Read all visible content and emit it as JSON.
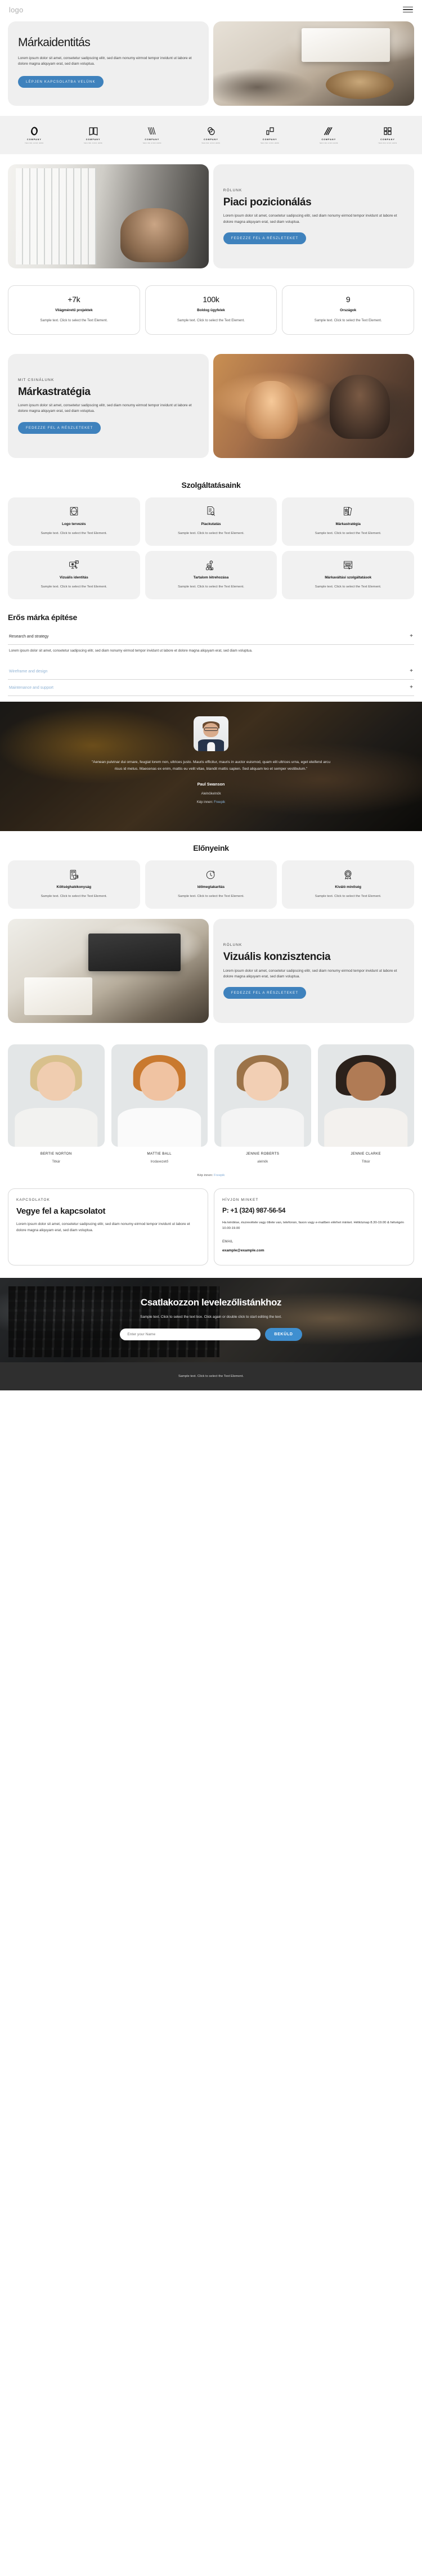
{
  "header": {
    "logo": "logo",
    "menu_icon": "hamburger-menu-icon"
  },
  "hero": {
    "title": "Márkaidentitás",
    "paragraph": "Lorem ipsum dolor sit amet, consetetur sadipscing elitr, sed diam nonumy eirmod tempor invidunt ut labore et dolore magna aliquyam erat, sed diam voluptua.",
    "cta": "LÉPJEN KAPCSOLATBA VELÜNK"
  },
  "logos": [
    {
      "name": "COMPANY",
      "tagline": "TAGLINE GOES HERE"
    },
    {
      "name": "COMPANY",
      "tagline": "TAGLINE GOES HERE"
    },
    {
      "name": "COMPANY",
      "tagline": "TAGLINE GOES HERE"
    },
    {
      "name": "COMPANY",
      "tagline": "TAGLINE GOES HERE"
    },
    {
      "name": "COMPANY",
      "tagline": "TAGLINE GOES HERE"
    },
    {
      "name": "COMPANY",
      "tagline": "TAGLINE GOES HERE"
    },
    {
      "name": "COMPANY",
      "tagline": "TAGLINE GOES HERE"
    }
  ],
  "about": {
    "eyebrow": "RÓLUNK",
    "title": "Piaci pozicionálás",
    "paragraph": "Lorem ipsum dolor sit amet, consetetur sadipscing elitr, sed diam nonumy eirmod tempor invidunt ut labore et dolore magna aliquyam erat, sed diam voluptua.",
    "cta": "FEDEZZE FEL A RÉSZLETEKET"
  },
  "stats": [
    {
      "number": "+7k",
      "label": "Világméretű projektek",
      "desc": "Sample text. Click to select the Text Element."
    },
    {
      "number": "100k",
      "label": "Boldog ügyfelek",
      "desc": "Sample text. Click to select the Text Element."
    },
    {
      "number": "9",
      "label": "Országok",
      "desc": "Sample text. Click to select the Text Element."
    }
  ],
  "strategy": {
    "eyebrow": "MIT CSINÁLUNK",
    "title": "Márkastratégia",
    "paragraph": "Lorem ipsum dolor sit amet, consetetur sadipscing elitr, sed diam nonumy eirmod tempor invidunt ut labore et dolore magna aliquyam erat, sed diam voluptua.",
    "cta": "FEDEZZE FEL A RÉSZLETEKET"
  },
  "services": {
    "title": "Szolgáltatásaink",
    "items": [
      {
        "icon": "logo-frame-icon",
        "title": "Logo tervezés",
        "desc": "Sample text. Click to select the Text Element."
      },
      {
        "icon": "document-search-icon",
        "title": "Piackutatás",
        "desc": "Sample text. Click to select the Text Element."
      },
      {
        "icon": "cards-star-icon",
        "title": "Márkastratégia",
        "desc": "Sample text. Click to select the Text Element."
      },
      {
        "icon": "monitor-design-icon",
        "title": "Vizuális identitás",
        "desc": "Sample text. Click to select the Text Element."
      },
      {
        "icon": "media-gear-icon",
        "title": "Tartalom létrehozása",
        "desc": "Sample text. Click to select the Text Element."
      },
      {
        "icon": "brand-cursor-icon",
        "title": "Márkaváltási szolgáltatások",
        "desc": "Sample text. Click to select the Text Element."
      }
    ]
  },
  "accordion": {
    "title": "Erős márka építése",
    "items": [
      {
        "label": "Research and strategy",
        "open": true,
        "body": "Lorem ipsum dolor sit amet, consetetur sadipscing elitr, sed diam nonumy eirmod tempor invidunt ut labore et dolore magna aliquyam erat, sed diam voluptua.",
        "toggle": "+"
      },
      {
        "label": "Wireframe and design",
        "open": false,
        "body": "",
        "toggle": "+"
      },
      {
        "label": "Maintenance and support",
        "open": false,
        "body": "",
        "toggle": "+"
      }
    ]
  },
  "testimonial": {
    "quote": "\"Aenean pulvinar dui ornare, feugiat lorem non, ultrices justo. Mauris efficitur, mauris in auctor euismod, quam elit ultrices urna, eget eleifend arcu risus id metus. Maecenas ex enim, mattis eu velit vitae, blandit mattis sapien. Sed aliquam leo et semper vestibulum.\"",
    "name": "Paul Swanson",
    "role": "Alelnökelnök",
    "credit_prefix": "Kép innen: ",
    "credit_link": "Freepik"
  },
  "benefits": {
    "title": "Előnyeink",
    "items": [
      {
        "icon": "cost-saving-icon",
        "title": "Költséghatékonyság",
        "desc": "Sample text. Click to select the Text Element."
      },
      {
        "icon": "clock-icon",
        "title": "Időmegtakarítás",
        "desc": "Sample text. Click to select the Text Element."
      },
      {
        "icon": "quality-badge-icon",
        "title": "Kiváló minőség",
        "desc": "Sample text. Click to select the Text Element."
      }
    ]
  },
  "visual": {
    "eyebrow": "RÓLUNK",
    "title": "Vizuális konzisztencia",
    "paragraph": "Lorem ipsum dolor sit amet, consetetur sadipscing elitr, sed diam nonumy eirmod tempor invidunt ut labore et dolore magna aliquyam erat, sed diam voluptua.",
    "cta": "FEDEZZE FEL A RÉSZLETEKET"
  },
  "team": {
    "members": [
      {
        "name": "BERTIE NORTON",
        "role": "Titkár"
      },
      {
        "name": "MATTIE BALL",
        "role": "Irodavezető"
      },
      {
        "name": "JENNIE ROBERTS",
        "role": "alelnök"
      },
      {
        "name": "JENNIE CLARKE",
        "role": "Titkár"
      }
    ],
    "credit_prefix": "Kép innen: ",
    "credit_link": "Freepik"
  },
  "contact": {
    "left": {
      "eyebrow": "KAPCSOLATOK",
      "title": "Vegye fel a kapcsolatot",
      "paragraph": "Lorem ipsum dolor sit amet, consetetur sadipscing elitr, sed diam nonumy eirmod tempor invidunt ut labore et dolore magna aliquyam erat, sed diam voluptua."
    },
    "right": {
      "eyebrow": "HÍVJON MINKET",
      "phone": "P: +1 (324) 987-56-54",
      "hours": "Ha kérdése, észrevétele vagy ötlete van, telefonon, faxon vagy e-mailben elérhet minket. Hétköznap 8.30-19.00 & hétvégén 10.00-19.00",
      "email_label": "EMAIL",
      "email": "example@example.com"
    }
  },
  "newsletter": {
    "title": "Csatlakozzon levelezőlistánkhoz",
    "subtitle": "Sample text. Click to select the text box. Click again or double click to start editing the text.",
    "placeholder": "Enter your Name",
    "button": "BEKÜLD"
  },
  "footer": {
    "text": "Sample text. Click to select the Text Element."
  },
  "colors": {
    "accent": "#3f82bd",
    "accent_light": "#3f8fd0",
    "surface": "#efefef",
    "footer_bg": "#2f2f2f"
  }
}
